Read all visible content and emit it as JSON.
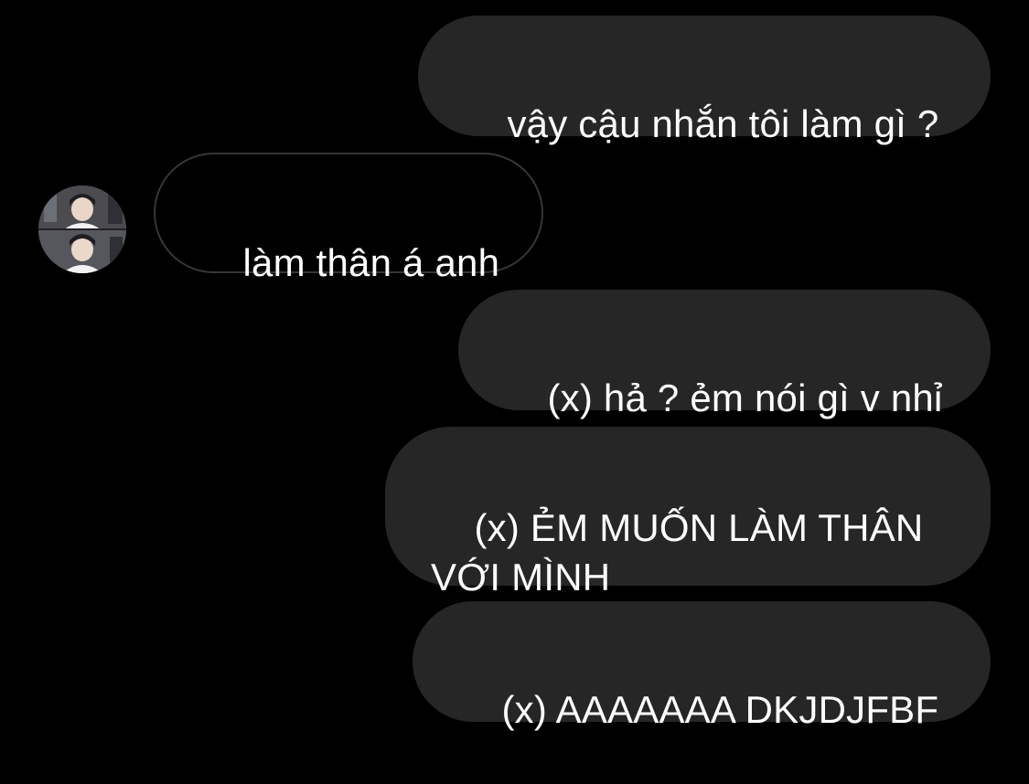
{
  "messages": [
    {
      "sender": "me",
      "text": "vậy cậu nhắn tôi làm gì ?"
    },
    {
      "sender": "other",
      "text": "làm thân á anh"
    },
    {
      "sender": "me",
      "text": "(x) hả ? ẻm nói gì v nhỉ"
    },
    {
      "sender": "me",
      "text": "(x) ẺM MUỐN LÀM THÂN\nVỚI MÌNH"
    },
    {
      "sender": "me",
      "text": "(x) AAAAAAA DKJDJFBF"
    }
  ],
  "avatar": {
    "icon": "profile-photo"
  },
  "colors": {
    "background": "#000000",
    "outgoing_bubble": "#262626",
    "incoming_border": "#363636",
    "text": "#ffffff"
  }
}
